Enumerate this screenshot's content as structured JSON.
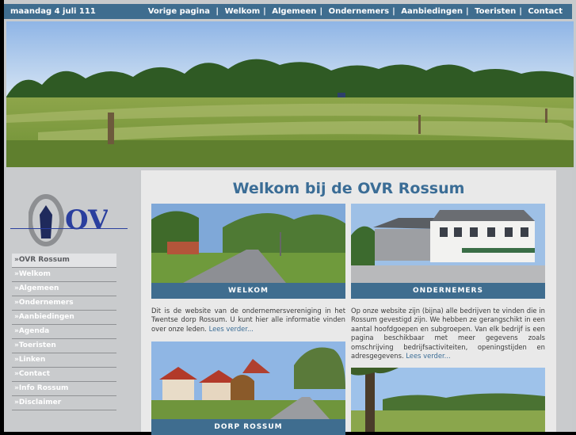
{
  "header": {
    "date": "maandag 4 juli 111",
    "nav": [
      "Vorige pagina",
      "Welkom",
      "Algemeen",
      "Ondernemers",
      "Aanbiedingen",
      "Toeristen",
      "Contact"
    ]
  },
  "logo": {
    "text": "OVR"
  },
  "sidebar": {
    "items": [
      "»OVR Rossum",
      "»Welkom",
      "»Algemeen",
      "»Ondernemers",
      "»Aanbiedingen",
      "»Agenda",
      "»Toeristen",
      "»Linken",
      "»Contact",
      "»Info Rossum",
      "»Disclaimer"
    ]
  },
  "main": {
    "title": "Welkom bij de OVR Rossum",
    "cards": [
      {
        "caption": "WELKOM",
        "text": "Dit is de website van de ondernemersvereniging in het Twentse dorp Rossum. U kunt hier alle informatie vinden over onze leden.",
        "link": "Lees verder..."
      },
      {
        "caption": "ONDERNEMERS",
        "text": "Op onze website zijn (bijna) alle bedrijven te vinden die in Rossum gevestigd zijn. We hebben ze gerangschikt in een aantal hoofdgoepen en subgroepen. Van elk bedrijf is een pagina beschikbaar met meer gegevens zoals omschrijving bedrijfsactiviteiten, openingstijden en adresgegevens.",
        "link": "Lees verder..."
      },
      {
        "caption": "DORP ROSSUM"
      }
    ]
  },
  "colors": {
    "accent": "#3f6d8f",
    "title": "#3b6d96"
  }
}
